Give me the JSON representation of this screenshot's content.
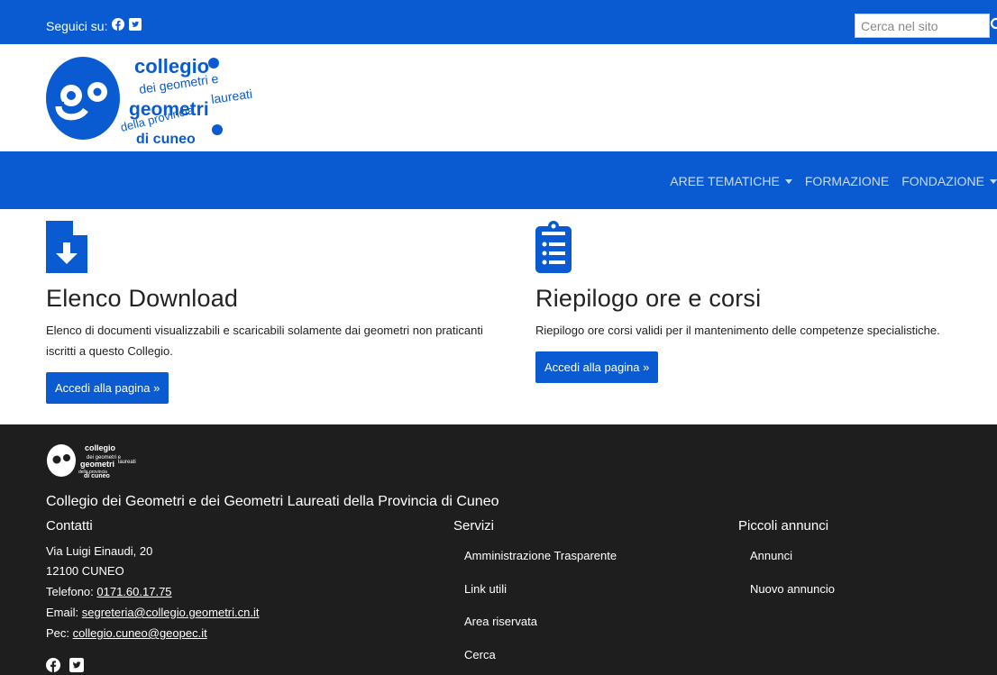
{
  "topbar": {
    "follow_label": "Seguici su:",
    "search_placeholder": "Cerca nel sito"
  },
  "logo": {
    "word1": "collegio",
    "word2": "dei geometri e",
    "word3": "geometri",
    "word4": "laureati",
    "word5": "della provincia",
    "word6": "di cuneo"
  },
  "nav": {
    "items": [
      {
        "label": "AREE TEMATICHE"
      },
      {
        "label": "FORMAZIONE"
      },
      {
        "label": "FONDAZIONE"
      }
    ]
  },
  "cards": [
    {
      "icon": "file-download-icon",
      "title": "Elenco Download",
      "text_line1": "Elenco di documenti visualizzabili e scaricabili solamente dai geometri non praticanti",
      "text_line2": "iscritti a questo Collegio.",
      "button": "Accedi alla pagina »"
    },
    {
      "icon": "clipboard-list-icon",
      "title": "Riepilogo ore e corsi",
      "text_line1": "Riepilogo ore corsi validi per il mantenimento delle competenze specialistiche.",
      "button": "Accedi alla pagina »"
    }
  ],
  "footer": {
    "org_name": "Collegio dei Geometri e dei Geometri Laureati della Provincia di Cuneo",
    "contacts": {
      "heading": "Contatti",
      "address": "Via Luigi Einaudi, 20",
      "city": "12100 CUNEO",
      "phone_label": "Telefono:",
      "phone": "0171.60.17.75",
      "email_label": "Email:",
      "email": "segreteria@collegio.geometri.cn.it",
      "pec_label": "Pec:",
      "pec": "collegio.cuneo@geopec.it"
    },
    "services": {
      "heading": "Servizi",
      "items": [
        "Amministrazione Trasparente",
        "Link utili",
        "Area riservata",
        "Cerca"
      ]
    },
    "ads": {
      "heading": "Piccoli annunci",
      "items": [
        "Annunci",
        "Nuovo annuncio"
      ]
    }
  },
  "colors": {
    "brand_blue": "#0a5bd1",
    "footer_bg": "#1e1e1e"
  }
}
